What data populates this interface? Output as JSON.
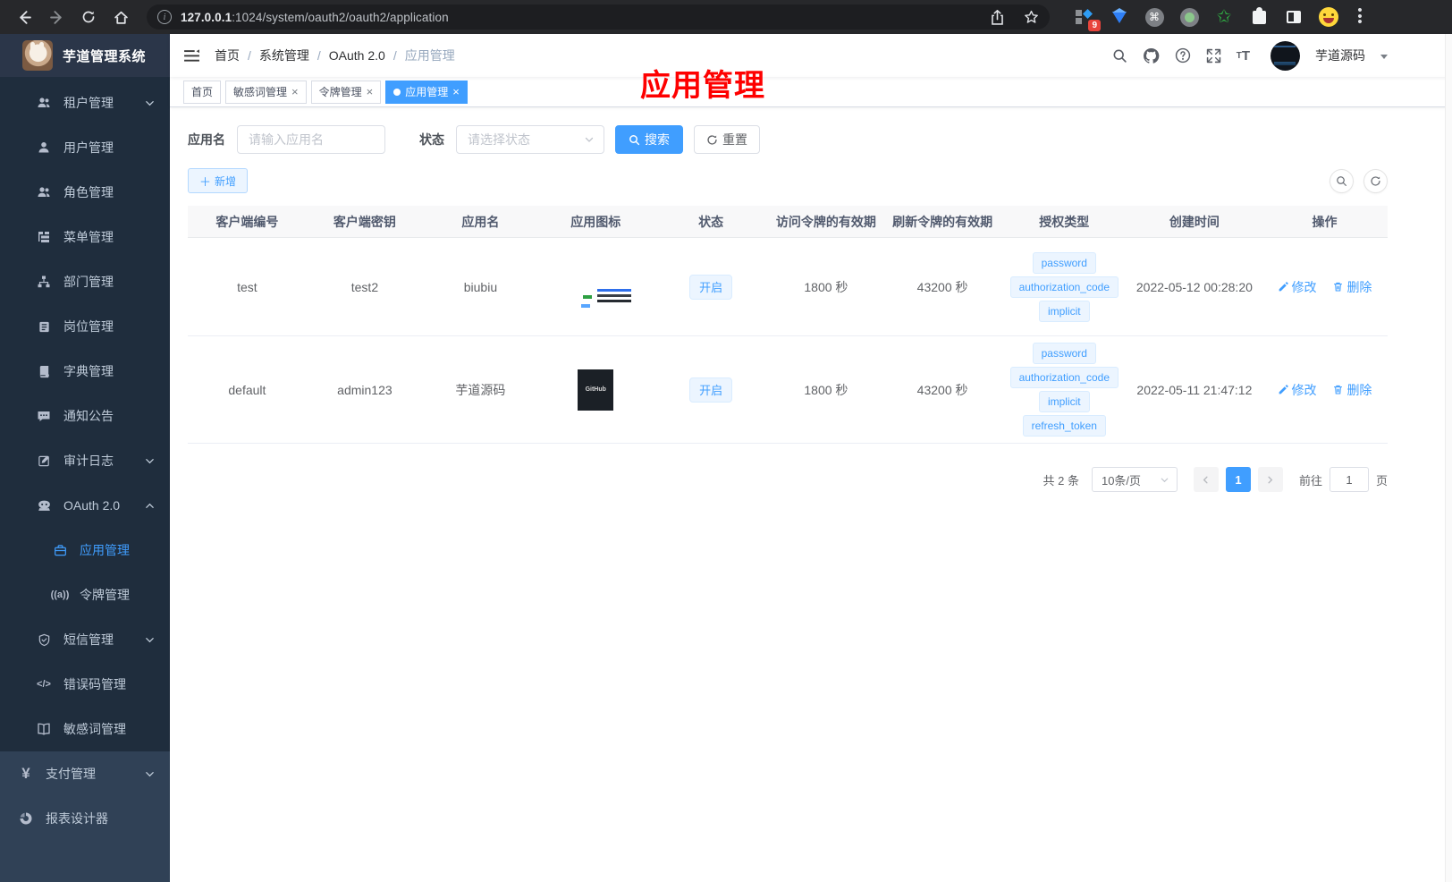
{
  "browser": {
    "url_host": "127.0.0.1",
    "url_rest": ":1024/system/oauth2/oauth2/application",
    "extension_badge": "9"
  },
  "sidebar": {
    "title": "芋道管理系统",
    "menu": [
      {
        "label": "租户管理"
      },
      {
        "label": "用户管理"
      },
      {
        "label": "角色管理"
      },
      {
        "label": "菜单管理"
      },
      {
        "label": "部门管理"
      },
      {
        "label": "岗位管理"
      },
      {
        "label": "字典管理"
      },
      {
        "label": "通知公告"
      },
      {
        "label": "审计日志"
      },
      {
        "label": "OAuth 2.0"
      },
      {
        "label": "应用管理"
      },
      {
        "label": "令牌管理"
      },
      {
        "label": "短信管理"
      },
      {
        "label": "错误码管理"
      },
      {
        "label": "敏感词管理"
      }
    ],
    "top_menu": [
      {
        "label": "支付管理"
      },
      {
        "label": "报表设计器"
      }
    ]
  },
  "navbar": {
    "breadcrumb": [
      "首页",
      "系统管理",
      "OAuth 2.0",
      "应用管理"
    ],
    "username": "芋道源码"
  },
  "tabs": [
    {
      "label": "首页"
    },
    {
      "label": "敏感词管理"
    },
    {
      "label": "令牌管理"
    },
    {
      "label": "应用管理"
    }
  ],
  "annotation": "应用管理",
  "filters": {
    "name_label": "应用名",
    "name_placeholder": "请输入应用名",
    "status_label": "状态",
    "status_placeholder": "请选择状态",
    "search_label": "搜索",
    "reset_label": "重置"
  },
  "toolbar": {
    "add_label": "新增"
  },
  "table": {
    "headers": [
      "客户端编号",
      "客户端密钥",
      "应用名",
      "应用图标",
      "状态",
      "访问令牌的有效期",
      "刷新令牌的有效期",
      "授权类型",
      "创建时间",
      "操作"
    ],
    "actions": {
      "edit": "修改",
      "delete": "删除"
    },
    "rows": [
      {
        "client_id": "test",
        "secret": "test2",
        "name": "biubiu",
        "icon": "dark-dashboard-screenshot",
        "status": "开启",
        "access_token_ttl": "1800 秒",
        "refresh_token_ttl": "43200 秒",
        "grants": [
          "password",
          "authorization_code",
          "implicit"
        ],
        "created": "2022-05-12 00:28:20"
      },
      {
        "client_id": "default",
        "secret": "admin123",
        "name": "芋道源码",
        "icon": "github-dark-logo",
        "icon_text": "GitHub",
        "status": "开启",
        "access_token_ttl": "1800 秒",
        "refresh_token_ttl": "43200 秒",
        "grants": [
          "password",
          "authorization_code",
          "implicit",
          "refresh_token"
        ],
        "created": "2022-05-11 21:47:12"
      }
    ]
  },
  "pagination": {
    "total": "共 2 条",
    "page_size": "10条/页",
    "current_page": "1",
    "goto_label": "前往",
    "goto_value": "1",
    "goto_unit": "页"
  },
  "colors": {
    "accent": "#409eff",
    "sidebar_bg": "#304156",
    "submenu_bg": "#1f2d3d",
    "tag_bg": "#ecf5ff",
    "tag_border": "#d9ecff",
    "annotation_red": "#fe0000"
  }
}
